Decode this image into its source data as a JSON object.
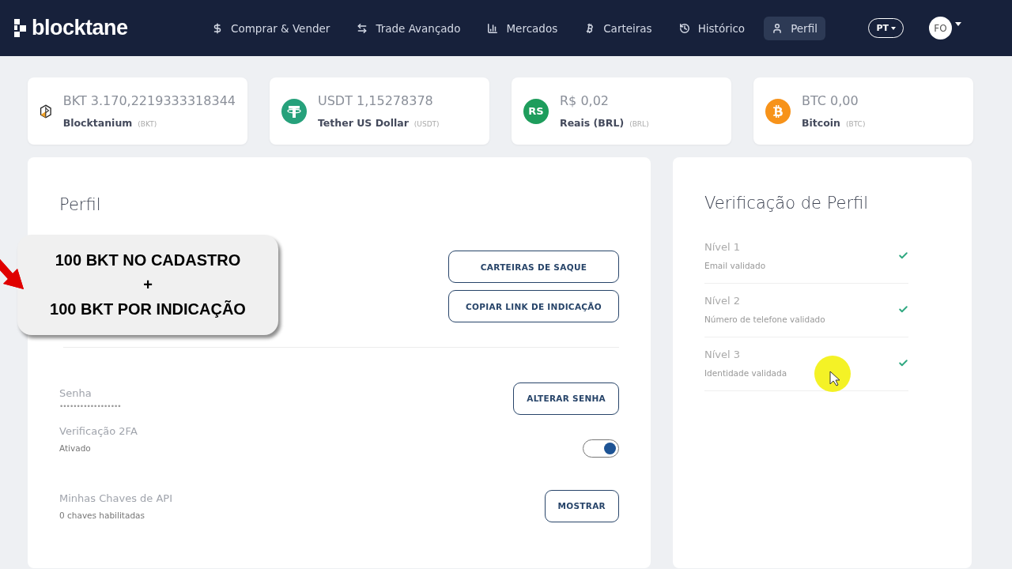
{
  "brand": {
    "name": "blocktane"
  },
  "nav": [
    {
      "label": "Comprar & Vender",
      "kind": "dollar",
      "selected": false
    },
    {
      "label": "Trade Avançado",
      "kind": "swap",
      "selected": false
    },
    {
      "label": "Mercados",
      "kind": "chart",
      "selected": false
    },
    {
      "label": "Carteiras",
      "kind": "bitcoin",
      "selected": false
    },
    {
      "label": "Histórico",
      "kind": "history",
      "selected": false
    },
    {
      "label": "Perfil",
      "kind": "user",
      "selected": true
    }
  ],
  "language": "PT",
  "avatar": "FO",
  "balances": [
    {
      "amount": "BKT 3.170,2219333318344",
      "name": "Blocktanium",
      "code": "(BKT)",
      "kind": "bkt"
    },
    {
      "amount": "USDT 1,15278378",
      "name": "Tether US Dollar",
      "code": "(USDT)",
      "kind": "usdt"
    },
    {
      "amount": "R$ 0,02",
      "name": "Reais (BRL)",
      "code": "(BRL)",
      "kind": "brl",
      "badge": "RS"
    },
    {
      "amount": "BTC 0,00",
      "name": "Bitcoin",
      "code": "(BTC)",
      "kind": "btc"
    }
  ],
  "profile": {
    "title": "Perfil",
    "buttons": [
      "CARTEIRAS DE SAQUE",
      "COPIAR LINK DE INDICAÇÃO"
    ],
    "rows": [
      {
        "kind": "button",
        "label": "Senha",
        "value": "••••••••••••••••••",
        "action": "ALTERAR SENHA"
      },
      {
        "kind": "toggle",
        "label": "Verificação 2FA",
        "value": "Ativado",
        "on": true
      },
      {
        "kind": "button",
        "label": "Minhas Chaves de API",
        "value": "0 chaves habilitadas",
        "action": "MOSTRAR"
      }
    ]
  },
  "verification": {
    "title": "Verificação de Perfil",
    "levels": [
      {
        "label": "Nível 1",
        "detail": "Email validado",
        "verified": true
      },
      {
        "label": "Nível 2",
        "detail": "Número de telefone validado",
        "verified": true
      },
      {
        "label": "Nível 3",
        "detail": "Identidade validada",
        "verified": true
      }
    ]
  },
  "callout": {
    "lines": [
      "100 BKT NO CADASTRO",
      "+",
      "100 BKT POR INDICAÇÃO"
    ]
  }
}
